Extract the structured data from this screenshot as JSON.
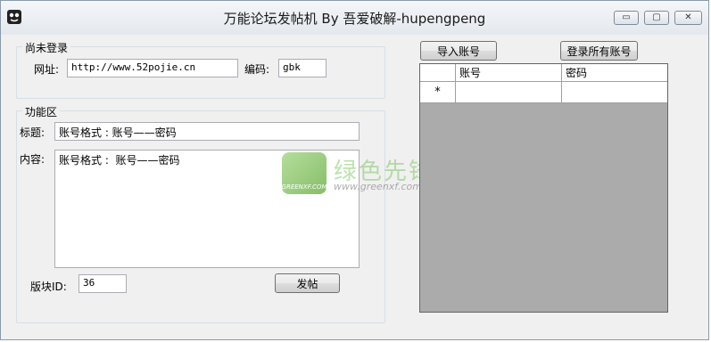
{
  "window": {
    "title": "万能论坛发帖机 By 吾爱破解-hupengpeng",
    "minimize_glyph": "▭",
    "maximize_glyph": "▢",
    "close_glyph": "✕"
  },
  "login_group": {
    "legend": "尚未登录",
    "url_label": "网址:",
    "url_value": "http://www.52pojie.cn",
    "encoding_label": "编码:",
    "encoding_value": "gbk"
  },
  "function_group": {
    "legend": "功能区",
    "title_label": "标题:",
    "title_value": "账号格式 :  账号——密码",
    "content_label": "内容:",
    "content_value": "账号格式 :  账号——密码",
    "board_id_label": "版块ID:",
    "board_id_value": "36",
    "post_button": "发帖"
  },
  "account_panel": {
    "import_button": "导入账号",
    "login_all_button": "登录所有账号",
    "columns": [
      "账号",
      "密码"
    ],
    "new_row_marker": "*"
  },
  "watermark": {
    "brand": "绿色先锋",
    "url": "www.greenxf.com",
    "logo_text": "GREENXF.COM"
  },
  "icons": {
    "app": "app-icon",
    "minimize": "minimize-icon",
    "maximize": "maximize-icon",
    "close": "close-icon"
  }
}
